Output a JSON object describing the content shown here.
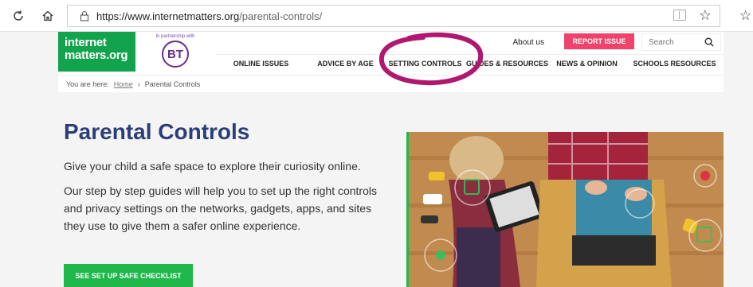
{
  "browser": {
    "url_domain": "https://www.internetmatters.org",
    "url_path": "/parental-controls/",
    "reload_icon": "reload-icon",
    "home_icon": "home-icon",
    "lock_icon": "lock-icon",
    "reader_icon": "reading-view-icon",
    "favorite_icon": "star-icon",
    "favorites_list_icon": "favorites-list-icon"
  },
  "header": {
    "logo_line1": "internet",
    "logo_line2": "matters.org",
    "partner_text": "In partnership with",
    "partner_logo": "BT",
    "about_label": "About us",
    "report_label": "REPORT ISSUE",
    "search_placeholder": "Search",
    "nav": [
      {
        "label": "ONLINE ISSUES"
      },
      {
        "label": "ADVICE BY AGE"
      },
      {
        "label": "SETTING CONTROLS"
      },
      {
        "label": "GUIDES & RESOURCES"
      },
      {
        "label": "NEWS & OPINION"
      },
      {
        "label": "SCHOOLS RESOURCES"
      }
    ]
  },
  "breadcrumb": {
    "prefix": "You are here:",
    "home": "Home",
    "separator": "›",
    "current": "Parental Controls"
  },
  "hero": {
    "title": "Parental Controls",
    "lead": "Give your child a safe space to explore their curiosity online.",
    "body": "Our step by step guides will help you to set up the right controls and privacy settings on the networks, gadgets, apps, and sites they use to give them a safer online experience.",
    "cta_label": "SEE SET UP SAFE CHECKLIST"
  },
  "colors": {
    "brand_green": "#12a34d",
    "title_blue": "#2c3e79",
    "report_pink": "#f0436b",
    "bt_purple": "#6a2c8f",
    "annotation_magenta": "#b0176f"
  }
}
